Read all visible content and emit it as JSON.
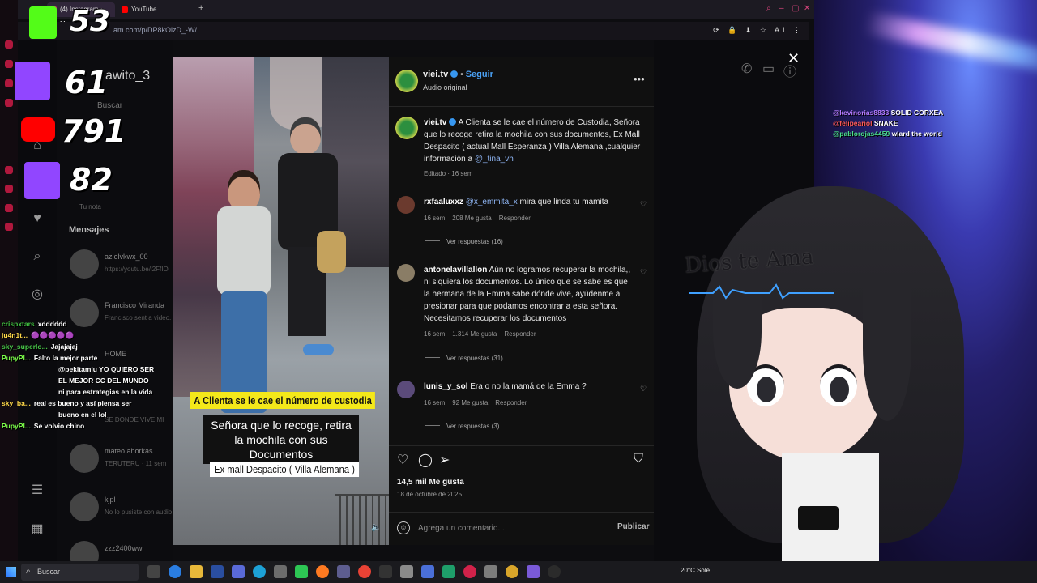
{
  "browser": {
    "tabs": [
      {
        "label": "(4) Instagram • Mens"
      },
      {
        "label": "YouTube"
      }
    ],
    "new_tab": "+",
    "url": "am.com/p/DP8kOizD_-W/",
    "url_icons": "⟳ 🔒 ⬇ ☆ AI ⋮"
  },
  "instagram_sidebar": {
    "username": "awito_3",
    "search_placeholder": "Buscar",
    "note": "Tu nota",
    "mensajes": "Mensajes",
    "dms": [
      {
        "name": "azielvkwx_00",
        "preview": "https://youtu.be/i2FfIO"
      },
      {
        "name": "Francisco Miranda",
        "preview": "Francisco sent a video."
      },
      {
        "name": "HOME",
        "preview": ""
      },
      {
        "name": "",
        "preview": "SE DONDE VIVE MI"
      },
      {
        "name": "mateo ahorkas",
        "preview": "TERUTERU · 11 sem"
      },
      {
        "name": "kjpl",
        "preview": "No lo pusiste con audio"
      },
      {
        "name": "zzz2400ww",
        "preview": ""
      }
    ]
  },
  "post": {
    "header": {
      "username": "viei.tv",
      "dot": "•",
      "follow": "Seguir",
      "audio": "Audio original",
      "more": "•••"
    },
    "video_captions": {
      "line1": "A Clienta se le cae el número de custodia",
      "line2": "Señora que lo recoge, retira la mochila con  sus Documentos",
      "line3": "Ex mall Despacito ( Villa Alemana )"
    },
    "caption": {
      "username": "viei.tv",
      "text": "A Clienta se le cae el número de Custodia, Señora que lo recoge retira la mochila con sus documentos, Ex Mall Despacito ( actual Mall Esperanza ) Villa Alemana ,cualquier información a ",
      "mention": "@_tina_vh",
      "meta": "Editado · 16 sem"
    },
    "comments": [
      {
        "username": "rxfaaluxxz",
        "mention": "@x_emmita_x",
        "text": " mira que linda tu mamita",
        "time": "16 sem",
        "likes": "208 Me gusta",
        "reply": "Responder",
        "replies": "Ver respuestas (16)",
        "avatar_color": "#6b3a2e"
      },
      {
        "username": "antonelavillallon",
        "mention": "",
        "text": " Aún no logramos recuperar la mochila,, ni siquiera los documentos. Lo único que se sabe es que la hermana de la Emma sabe dónde vive, ayúdenme a presionar para que podamos encontrar a esta señora. Necesitamos recuperar los documentos",
        "time": "16 sem",
        "likes": "1.314 Me gusta",
        "reply": "Responder",
        "replies": "Ver respuestas (31)",
        "avatar_color": "#8a7d66"
      },
      {
        "username": "lunis_y_sol",
        "mention": "",
        "text": " Era o no la mamá de la Emma ?",
        "time": "16 sem",
        "likes": "92 Me gusta",
        "reply": "Responder",
        "replies": "Ver respuestas (3)",
        "avatar_color": "#5b4b7a"
      }
    ],
    "likes": "14,5 mil Me gusta",
    "date": "18 de octubre de 2025",
    "comment_placeholder": "Agrega un comentario...",
    "publish": "Publicar"
  },
  "stream_overlay": {
    "counters": [
      {
        "value": "53",
        "color": "#53fc18",
        "label": "K"
      },
      {
        "value": "61",
        "color": "#9146ff"
      },
      {
        "value": "791",
        "color": "#ff0000"
      },
      {
        "value": "82",
        "color": "#9146ff"
      }
    ],
    "chat": [
      {
        "user": "crispxtars",
        "msg": "xdddddd",
        "color": "#3fbf3f"
      },
      {
        "user": "ju4n1t...",
        "msg": "🟣🟣🟣🟣🟣",
        "color": "#ffd84a"
      },
      {
        "user": "sky_superlo...",
        "msg": "Jajajajaj",
        "color": "#49c949"
      },
      {
        "user": "PupyPl...",
        "msg": "Falto la mejor parte",
        "color": "#7cff4a"
      },
      {
        "user": "",
        "msg": "@pekitamiu YO QUIERO SER",
        "color": "#6f8cff"
      },
      {
        "user": "",
        "msg": "EL MEJOR CC DEL MUNDO",
        "color": "#ffffff"
      },
      {
        "user": "",
        "msg": "ni para estrategias en la vida",
        "color": "#ffffff"
      },
      {
        "user": "sky_ba...",
        "msg": "real es bueno y así piensa ser",
        "color": "#ffd84a"
      },
      {
        "user": "",
        "msg": "bueno en el lol",
        "color": "#ffffff"
      },
      {
        "user": "PupyPl...",
        "msg": "Se volvio chino",
        "color": "#7cff4a"
      }
    ],
    "desktop_chat": [
      {
        "user": "@kevinorias8833",
        "msg": "SOLID CORXEA",
        "color": "#b57cff"
      },
      {
        "user": "@felipeariol",
        "msg": "SNAKE",
        "color": "#ff5a5a"
      },
      {
        "user": "@pablorojas4459",
        "msg": "wlard the world",
        "color": "#4adf8a"
      }
    ],
    "avatar_text": "Dios te Ama"
  },
  "taskbar": {
    "search": "Buscar",
    "weather": "20°C  Sole"
  }
}
